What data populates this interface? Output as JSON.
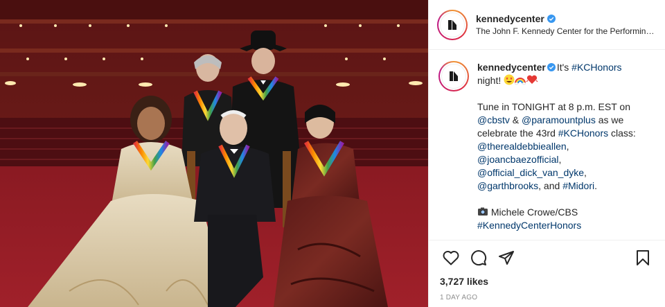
{
  "post": {
    "image_alt": "",
    "header": {
      "username": "kennedycenter",
      "subtitle": "The John F. Kennedy Center for the Performing Arts"
    },
    "caption": {
      "username": "kennedycenter",
      "intro": "It's ",
      "hashtag_kchonors": "#KCHonors",
      "line1_end": " night!",
      "emojis": [
        "grinning-star-eyes-emoji",
        "rainbow-emoji",
        "heart-emoji"
      ],
      "p2_text1": "Tune in TONIGHT at 8 p.m. EST on ",
      "mention_cbstv": "@cbstv",
      "amp": " & ",
      "mention_paramount": "@paramountplus",
      "p2_text2": " as we celebrate the 43rd ",
      "hashtag_kchonors_2": "#KCHonors",
      "p2_text3": " class: ",
      "mention_debbie": "@therealdebbieallen",
      "comma1": ",",
      "mention_joan": "@joancbaezofficial",
      "comma2": ",",
      "mention_dick": "@official_dick_van_dyke",
      "comma3": ",",
      "mention_garth": "@garthbrooks",
      "and_text": ", and ",
      "hashtag_midori": "#Midori",
      "period": ".",
      "photo_credit": "Michele Crowe/CBS",
      "hashtag_kch": "#KennedyCenterHonors"
    },
    "likes": "3,727 likes",
    "timestamp": "1 DAY AGO"
  },
  "colors": {
    "link": "#00376b",
    "verified": "#3897f0",
    "text": "#262626",
    "muted": "#8e8e8e"
  }
}
